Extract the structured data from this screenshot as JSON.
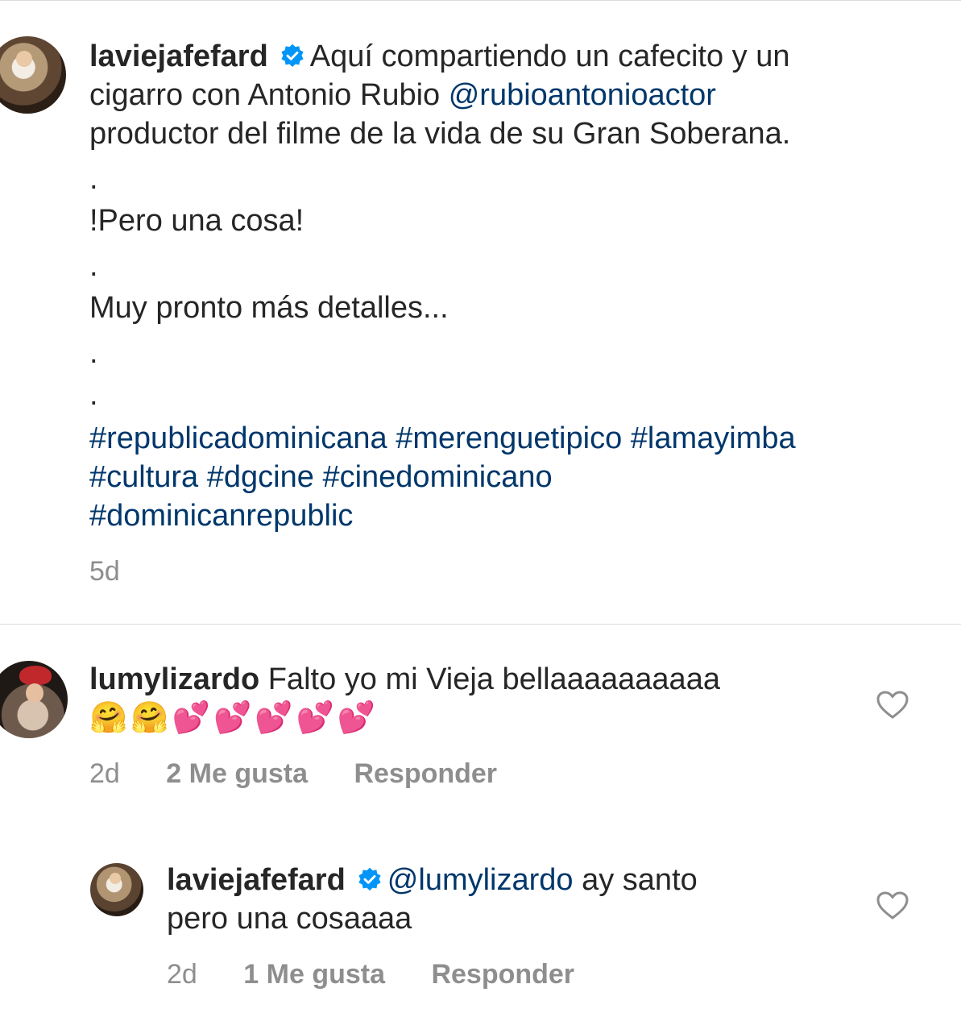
{
  "post": {
    "username": "laviejafefard",
    "caption_line1": "Aquí compartiendo un cafecito y un",
    "caption_line2a": "cigarro con Antonio Rubio ",
    "mention": "@rubioantonioactor",
    "caption_line3": "productor del filme de la vida de su Gran Soberana.",
    "dot1": ".",
    "line_pero": "!Pero una cosa!",
    "dot2": ".",
    "line_pronto": "Muy pronto más detalles...",
    "dot3": ".",
    "dot4": ".",
    "hashtags_line1": [
      "#republicadominicana",
      "#merenguetipico",
      "#lamayimba"
    ],
    "hashtags_line2": [
      "#cultura",
      "#dgcine",
      "#cinedominicano"
    ],
    "hashtags_line3": [
      "#dominicanrepublic"
    ],
    "time": "5d"
  },
  "comment": {
    "username": "lumylizardo",
    "text": "Falto yo mi Vieja bellaaaaaaaaaa",
    "emojis": "🤗🤗💕💕💕💕💕",
    "time": "2d",
    "likes": "2 Me gusta",
    "reply_label": "Responder"
  },
  "reply": {
    "username": "laviejafefard",
    "mention": "@lumylizardo",
    "text_line1": " ay santo",
    "text_line2": "pero una cosaaaa",
    "time": "2d",
    "likes": "1 Me gusta",
    "reply_label": "Responder"
  },
  "colors": {
    "text": "#262626",
    "link": "#00376b",
    "meta": "#8e8e8e",
    "verified": "#0095f6",
    "divider": "#dbdbdb"
  },
  "icons": [
    "verified-badge-icon",
    "heart-icon"
  ]
}
